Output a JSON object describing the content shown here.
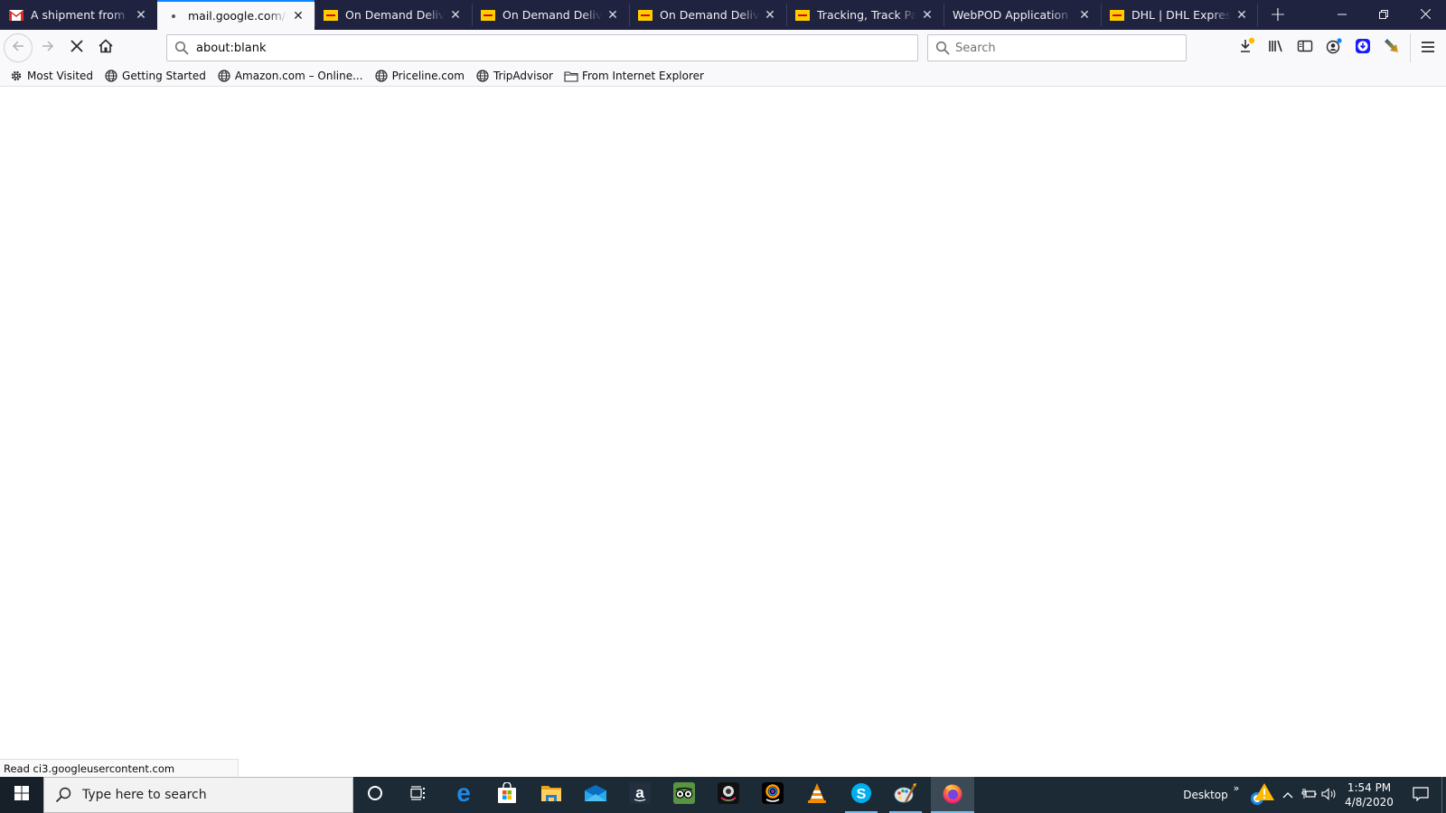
{
  "browser": {
    "tabs": [
      {
        "title": "A shipment from order",
        "favicon": "gmail-icon",
        "active": false
      },
      {
        "title": "mail.google.com/mail",
        "favicon": "loading-dot-icon",
        "active": true
      },
      {
        "title": "On Demand Delivery",
        "favicon": "dhl-icon",
        "active": false
      },
      {
        "title": "On Demand Delivery",
        "favicon": "dhl-icon",
        "active": false
      },
      {
        "title": "On Demand Delivery",
        "favicon": "dhl-icon",
        "active": false
      },
      {
        "title": "Tracking, Track Parcels",
        "favicon": "dhl-icon",
        "active": false
      },
      {
        "title": "WebPOD Application",
        "favicon": "",
        "active": false
      },
      {
        "title": "DHL | DHL Express | E",
        "favicon": "dhl-icon",
        "active": false
      }
    ],
    "new_tab_label": "+",
    "window_controls": {
      "minimize": "—",
      "restore": "❐",
      "close": "✕"
    },
    "url": "about:blank",
    "search_placeholder": "Search",
    "bookmarks": [
      {
        "label": "Most Visited",
        "icon": "gear-icon"
      },
      {
        "label": "Getting Started",
        "icon": "globe-icon"
      },
      {
        "label": "Amazon.com – Online...",
        "icon": "globe-icon"
      },
      {
        "label": "Priceline.com",
        "icon": "globe-icon"
      },
      {
        "label": "TripAdvisor",
        "icon": "globe-icon"
      },
      {
        "label": "From Internet Explorer",
        "icon": "folder-icon"
      }
    ],
    "status_text": "Read ci3.googleusercontent.com"
  },
  "taskbar": {
    "search_placeholder": "Type here to search",
    "apps": [
      "cortana",
      "task-view",
      "edge",
      "store",
      "file-explorer",
      "mail",
      "amazon",
      "tripadvisor",
      "webcam",
      "webcam-2",
      "vlc",
      "skype",
      "paint",
      "firefox"
    ],
    "desktop_label": "Desktop",
    "overflow_label": "»",
    "time": "1:54 PM",
    "date": "4/8/2020"
  },
  "colors": {
    "tabstrip_bg": "#1f2340",
    "active_tab_accent": "#0a84ff",
    "taskbar_bg": "#1c2a36",
    "dhl_yellow": "#ffcc00"
  }
}
